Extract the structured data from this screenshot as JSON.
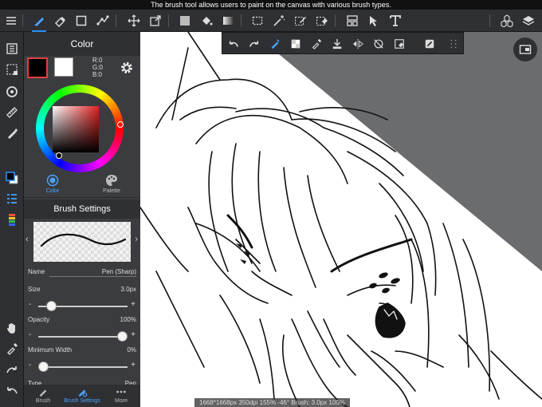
{
  "tooltip": "The brush tool allows users to paint on the canvas with various brush types.",
  "toolbar": {
    "tools": [
      "menu-icon",
      "brush-icon",
      "eraser-icon",
      "rectangle-icon",
      "vector-icon",
      "move-icon",
      "transform-icon",
      "fill-color-icon",
      "bucket-icon",
      "gradient-icon",
      "selection-icon",
      "magic-wand-icon",
      "select-pen-icon",
      "select-eraser-icon",
      "frame-divide-icon",
      "operation-icon",
      "text-icon",
      "material-icon",
      "layers-icon"
    ]
  },
  "float_bar": {
    "tools": [
      "undo-icon",
      "redo-icon",
      "brush-tool-icon",
      "color-swatch-icon",
      "eyedropper-icon",
      "save-icon",
      "flip-icon",
      "rotate-reset-icon",
      "clear-icon",
      "invert-icon",
      "grip-icon"
    ]
  },
  "color_panel": {
    "title": "Color",
    "r": "R:0",
    "g": "G:0",
    "b": "B:0",
    "fg_color": "#000000",
    "bg_color": "#ffffff",
    "tab_color": "Color",
    "tab_palette": "Palette"
  },
  "brush_panel": {
    "title": "Brush Settings",
    "name_label": "Name",
    "name_value": "Pen (Sharp)",
    "size_label": "Size",
    "size_value": "3.0px",
    "size_level": 0.1,
    "opacity_label": "Opacity",
    "opacity_value": "100%",
    "opacity_level": 1.0,
    "minwidth_label": "Minimum Width",
    "minwidth_value": "0%",
    "minwidth_level": 0.0,
    "type_label": "Type",
    "type_value": "Pen"
  },
  "bottom_tabs": {
    "brush": "Brush",
    "brush_settings": "Brush Settings",
    "more": "More"
  },
  "status_bar": "1668*1668px 350dpi 155% -46° Brush: 3.0px 100%",
  "colors": {
    "accent": "#2a8ff2",
    "panel": "#3a3c40",
    "chrome": "#2e3034",
    "canvas_bg": "#6a6c70"
  }
}
